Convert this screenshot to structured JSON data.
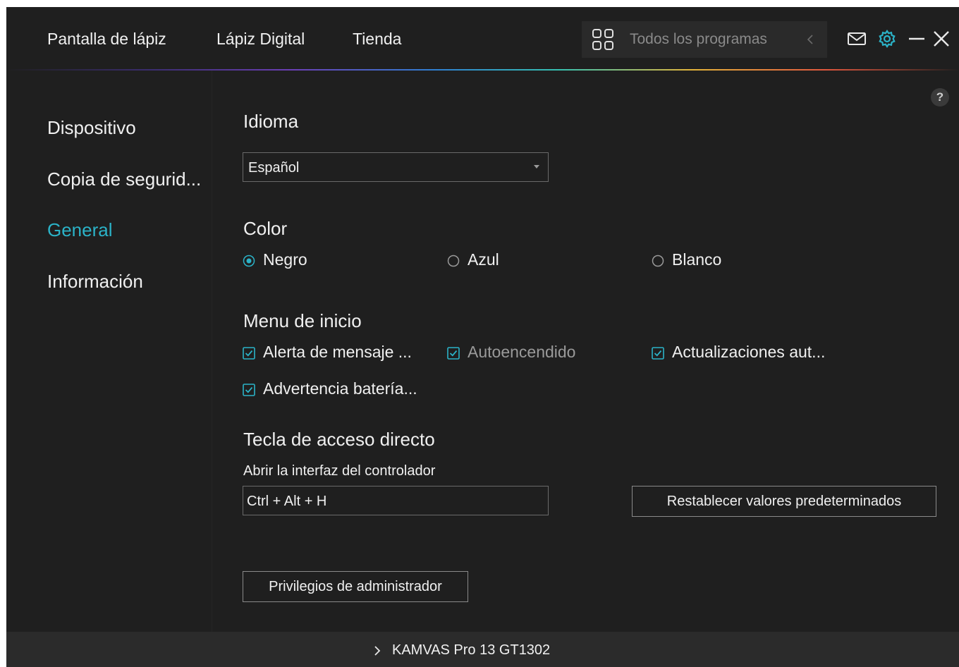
{
  "topbar": {
    "nav": [
      "Pantalla de lápiz",
      "Lápiz Digital",
      "Tienda"
    ],
    "programs_label": "Todos los programas",
    "icons": [
      "grid-icon",
      "chevron-left-icon",
      "mail-icon",
      "gear-icon",
      "minimize-icon",
      "close-icon"
    ],
    "accent_color": "#2bb3c8"
  },
  "sidebar": {
    "items": [
      "Dispositivo",
      "Copia de segurid...",
      "General",
      "Información"
    ],
    "active": "General"
  },
  "main": {
    "help": "?",
    "language": {
      "title": "Idioma",
      "selected": "Español"
    },
    "color": {
      "title": "Color",
      "options": [
        {
          "label": "Negro",
          "checked": true
        },
        {
          "label": "Azul",
          "checked": false
        },
        {
          "label": "Blanco",
          "checked": false
        }
      ]
    },
    "startup": {
      "title": "Menu de inicio",
      "options": [
        {
          "label": "Alerta de mensaje ...",
          "checked": true
        },
        {
          "label": "Autoencendido",
          "checked": true
        },
        {
          "label": "Actualizaciones aut...",
          "checked": true
        },
        {
          "label": "Advertencia batería...",
          "checked": true
        }
      ]
    },
    "hotkey": {
      "title": "Tecla de acceso directo",
      "label": "Abrir la interfaz del controlador",
      "value": "Ctrl + Alt + H",
      "reset_button": "Restablecer valores predeterminados"
    },
    "admin_button": "Privilegios de administrador"
  },
  "footer": {
    "device": "KAMVAS Pro 13 GT1302"
  }
}
